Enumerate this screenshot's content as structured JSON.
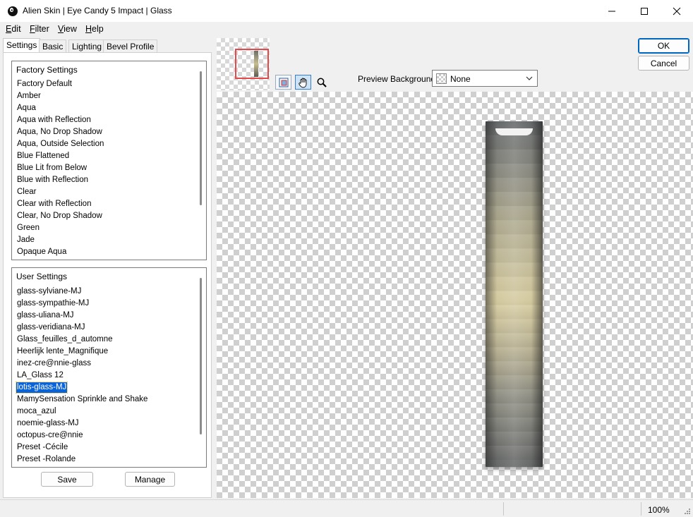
{
  "window": {
    "title": "Alien Skin | Eye Candy 5 Impact | Glass"
  },
  "menu": [
    {
      "label": "Edit",
      "key": "E",
      "rest": "dit"
    },
    {
      "label": "Filter",
      "key": "F",
      "rest": "ilter"
    },
    {
      "label": "View",
      "key": "V",
      "rest": "iew"
    },
    {
      "label": "Help",
      "key": "H",
      "rest": "elp"
    }
  ],
  "tabs": [
    "Settings",
    "Basic",
    "Lighting",
    "Bevel Profile"
  ],
  "factory": {
    "header": "Factory Settings",
    "items": [
      "Factory Default",
      "Amber",
      "Aqua",
      "Aqua with Reflection",
      "Aqua, No Drop Shadow",
      "Aqua, Outside Selection",
      "Blue Flattened",
      "Blue Lit from Below",
      "Blue with Reflection",
      "Clear",
      "Clear with Reflection",
      "Clear, No Drop Shadow",
      "Green",
      "Jade",
      "Opaque Aqua"
    ]
  },
  "user": {
    "header": "User Settings",
    "items": [
      "glass-sylviane-MJ",
      "glass-sympathie-MJ",
      "glass-uliana-MJ",
      "glass-veridiana-MJ",
      "Glass_feuilles_d_automne",
      "Heerlijk lente_Magnifique",
      "inez-cre@nnie-glass",
      "LA_Glass 12",
      "lotis-glass-MJ",
      "MamySensation Sprinkle and Shake",
      "moca_azul",
      "noemie-glass-MJ",
      "octopus-cre@nnie",
      "Preset -Cécile",
      "Preset -Rolande"
    ],
    "selected": "lotis-glass-MJ"
  },
  "buttons": {
    "save": "Save",
    "manage": "Manage",
    "ok": "OK",
    "cancel": "Cancel"
  },
  "preview_background": {
    "label": "Preview Background:",
    "value": "None"
  },
  "status": {
    "zoom": "100%"
  },
  "colors": {
    "selection": "#0a64d8",
    "nav_rect": "#e04a4a",
    "accent": "#0067c0"
  },
  "icons": [
    "app-icon",
    "minimize-icon",
    "maximize-icon",
    "close-icon",
    "navigate-preview-icon",
    "hand-pan-icon",
    "zoom-magnifier-icon",
    "chevron-down-icon",
    "resize-grip-icon"
  ]
}
